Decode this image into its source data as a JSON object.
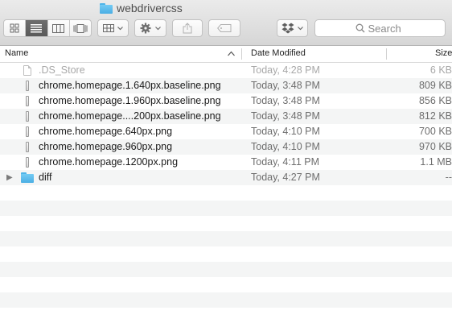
{
  "window": {
    "title": "webdrivercss"
  },
  "toolbar": {
    "view_buttons": [
      {
        "name": "icon-view",
        "icon": "grid-4-icon",
        "active": false
      },
      {
        "name": "list-view",
        "icon": "list-icon",
        "active": true
      },
      {
        "name": "column-view",
        "icon": "columns-icon",
        "active": false
      },
      {
        "name": "cover-flow-view",
        "icon": "coverflow-icon",
        "active": false
      }
    ],
    "arrange_icon": "arrange-grid-icon",
    "action_icon": "gear-icon",
    "share_icon": "share-icon",
    "tag_icon": "tag-icon",
    "dropbox_icon": "dropbox-icon",
    "search_placeholder": "Search"
  },
  "columns": {
    "name": "Name",
    "date": "Date Modified",
    "size": "Size",
    "sort_indicator": "▲"
  },
  "files": [
    {
      "name": ".DS_Store",
      "date": "Today, 4:28 PM",
      "size": "6 KB",
      "type": "doc",
      "dim": true
    },
    {
      "name": "chrome.homepage.1.640px.baseline.png",
      "date": "Today, 3:48 PM",
      "size": "809 KB",
      "type": "png"
    },
    {
      "name": "chrome.homepage.1.960px.baseline.png",
      "date": "Today, 3:48 PM",
      "size": "856 KB",
      "type": "png"
    },
    {
      "name": "chrome.homepage....200px.baseline.png",
      "date": "Today, 3:48 PM",
      "size": "812 KB",
      "type": "png"
    },
    {
      "name": "chrome.homepage.640px.png",
      "date": "Today, 4:10 PM",
      "size": "700 KB",
      "type": "png"
    },
    {
      "name": "chrome.homepage.960px.png",
      "date": "Today, 4:10 PM",
      "size": "970 KB",
      "type": "png"
    },
    {
      "name": "chrome.homepage.1200px.png",
      "date": "Today, 4:11 PM",
      "size": "1.1 MB",
      "type": "png"
    },
    {
      "name": "diff",
      "date": "Today, 4:27 PM",
      "size": "--",
      "type": "folder",
      "disclosure": "▶"
    }
  ],
  "empty_rows": 9
}
